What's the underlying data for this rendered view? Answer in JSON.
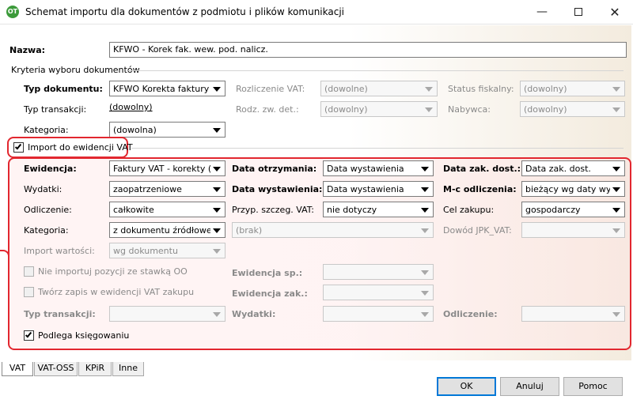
{
  "window": {
    "title": "Schemat importu dla dokumentów z podmiotu i plików komunikacji",
    "app_icon_text": "OT",
    "minimize_glyph": "—",
    "close_glyph": "✕"
  },
  "header": {
    "name_label": "Nazwa:",
    "name_value": "KFWO - Korek fak. wew. pod. nalicz.",
    "criteria_title": "Kryteria wyboru dokumentów"
  },
  "criteria": {
    "doc_type_label": "Typ dokumentu:",
    "doc_type_value": "KFWO Korekta faktury we",
    "trans_type_label": "Typ transakcji:",
    "trans_type_value": "(dowolny)",
    "category_label": "Kategoria:",
    "category_value": "(dowolna)",
    "vat_settlement_label": "Rozliczenie VAT:",
    "vat_settlement_value": "(dowolne)",
    "special_kind_label": "Rodz. zw. det.:",
    "special_kind_value": "(dowolny)",
    "fiscal_status_label": "Status fiskalny:",
    "fiscal_status_value": "(dowolny)",
    "buyer_label": "Nabywca:",
    "buyer_value": "(dowolny)"
  },
  "vat_import": {
    "checkbox_label": "Import do ewidencji VAT",
    "checked": true
  },
  "vat": {
    "register_label": "Ewidencja:",
    "register_value": "Faktury VAT - korekty (za",
    "expenses_label": "Wydatki:",
    "expenses_value": "zaopatrzeniowe",
    "deduction_label": "Odliczenie:",
    "deduction_value": "całkowite",
    "category_label": "Kategoria:",
    "category_value": "z dokumentu źródłowego",
    "category_extra_value": "(brak)",
    "import_values_label": "Import wartości:",
    "import_values_value": "wg dokumentu",
    "date_received_label": "Data otrzymania:",
    "date_received_value": "Data wystawienia",
    "date_issued_label": "Data wystawienia:",
    "date_issued_value": "Data wystawienia",
    "special_vat_label": "Przyp. szczeg. VAT:",
    "special_vat_value": "nie dotyczy",
    "date_purchase_label": "Data zak. dost.:",
    "date_purchase_value": "Data zak. dost.",
    "month_deduction_label": "M-c odliczenia:",
    "month_deduction_value": "bieżący wg daty wysta",
    "purpose_label": "Cel zakupu:",
    "purpose_value": "gospodarczy",
    "proof_label": "Dowód JPK_VAT:",
    "proof_value": "",
    "skip_oo_label": "Nie importuj pozycji ze stawką OO",
    "create_entry_label": "Twórz zapis w ewidencji VAT zakupu",
    "register_sp_label": "Ewidencja sp.:",
    "register_zak_label": "Ewidencja zak.:",
    "trans_type_label": "Typ transakcji:",
    "expenses2_label": "Wydatki:",
    "deduction2_label": "Odliczenie:",
    "posting_label": "Podlega księgowaniu",
    "posting_checked": true
  },
  "tabs": [
    {
      "label": "VAT"
    },
    {
      "label": "VAT-OSS"
    },
    {
      "label": "KPiR"
    },
    {
      "label": "Inne"
    }
  ],
  "buttons": {
    "ok": "OK",
    "cancel": "Anuluj",
    "help": "Pomoc"
  },
  "colors": {
    "highlight": "#e2272f",
    "focus": "#0078d7"
  }
}
